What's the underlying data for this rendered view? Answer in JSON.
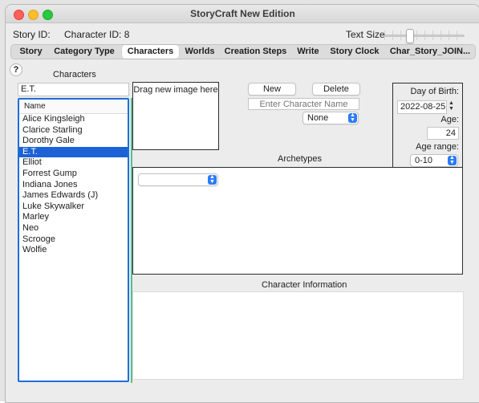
{
  "window": {
    "title": "StoryCraft New Edition"
  },
  "infobar": {
    "story_id_label": "Story ID:",
    "character_id_label": "Character ID: 8",
    "text_size_label": "Text Size"
  },
  "tabs": [
    {
      "label": "Story"
    },
    {
      "label": "Category  Type"
    },
    {
      "label": "Characters",
      "selected": true
    },
    {
      "label": "Worlds"
    },
    {
      "label": "Creation Steps"
    },
    {
      "label": "Write"
    },
    {
      "label": "Story Clock"
    },
    {
      "label": "Char_Story_JOIN..."
    }
  ],
  "characters": {
    "section_title": "Characters",
    "search_value": "E.T.",
    "list_header": "Name",
    "items": [
      "Alice Kingsleigh",
      "Clarice Starling",
      "Dorothy Gale",
      "E.T.",
      "Elliot",
      "Forrest Gump",
      "Indiana Jones",
      "James Edwards (J)",
      "Luke Skywalker",
      "Marley",
      "Neo",
      "Scrooge",
      "Wolfie"
    ],
    "selected": "E.T."
  },
  "image_drop": {
    "hint": "Drag new image here"
  },
  "actions": {
    "new_label": "New",
    "delete_label": "Delete",
    "name_placeholder": "Enter Character Name",
    "role_select": "None"
  },
  "birth": {
    "dob_label": "Day of Birth:",
    "dob_value": "2022-08-25",
    "age_label": "Age:",
    "age_value": "24",
    "age_range_label": "Age range:",
    "age_range_value": "0-10"
  },
  "archetypes": {
    "title": "Archetypes",
    "select_value": ""
  },
  "character_info": {
    "title": "Character Information"
  },
  "colors": {
    "accent": "#1c62d6",
    "list_border": "#1f6fd7",
    "divider_green": "#56c08a",
    "close": "#fe5f57",
    "minimize": "#febc2e",
    "zoom": "#28c840"
  },
  "icons": {
    "help": "question-mark-icon",
    "stepper": "up-down-stepper-icon",
    "popup": "up-down-chevron-icon"
  },
  "text_size_level": 0.3
}
